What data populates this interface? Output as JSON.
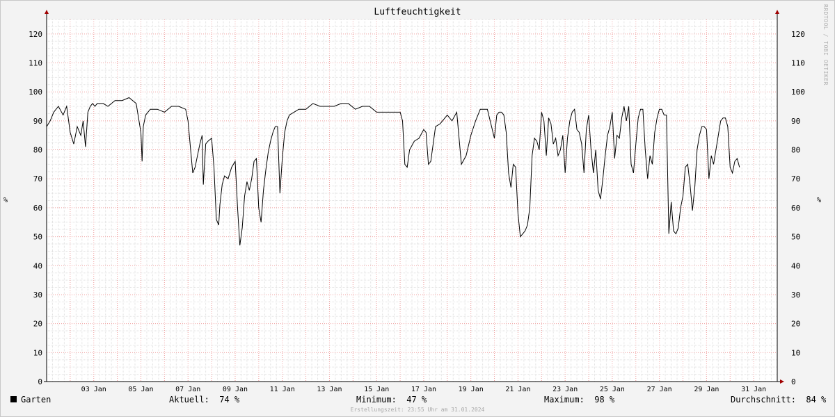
{
  "chart_data": {
    "type": "line",
    "title": "Luftfeuchtigkeit",
    "ylabel": "%",
    "ylim": [
      0,
      125
    ],
    "yticks": [
      0,
      10,
      20,
      30,
      40,
      50,
      60,
      70,
      80,
      90,
      100,
      110,
      120
    ],
    "xlim_days": [
      1.0,
      32.0
    ],
    "xtick_labels": [
      "03 Jan",
      "05 Jan",
      "07 Jan",
      "09 Jan",
      "11 Jan",
      "13 Jan",
      "15 Jan",
      "17 Jan",
      "19 Jan",
      "21 Jan",
      "23 Jan",
      "25 Jan",
      "27 Jan",
      "29 Jan",
      "31 Jan"
    ],
    "xtick_days": [
      3,
      5,
      7,
      9,
      11,
      13,
      15,
      17,
      19,
      21,
      23,
      25,
      27,
      29,
      31
    ],
    "grid": true,
    "series": [
      {
        "name": "Garten",
        "color": "#000000",
        "x_day": [
          1.0,
          1.15,
          1.3,
          1.5,
          1.7,
          1.85,
          2.0,
          2.15,
          2.3,
          2.45,
          2.55,
          2.65,
          2.75,
          2.85,
          2.95,
          3.05,
          3.15,
          3.25,
          3.4,
          3.6,
          3.9,
          4.2,
          4.5,
          4.8,
          5.0,
          5.05,
          5.1,
          5.2,
          5.4,
          5.7,
          6.0,
          6.3,
          6.6,
          6.9,
          7.0,
          7.1,
          7.2,
          7.3,
          7.5,
          7.6,
          7.65,
          7.75,
          7.85,
          8.0,
          8.1,
          8.2,
          8.3,
          8.35,
          8.45,
          8.55,
          8.7,
          8.85,
          9.0,
          9.1,
          9.2,
          9.3,
          9.4,
          9.5,
          9.6,
          9.7,
          9.8,
          9.9,
          10.0,
          10.1,
          10.2,
          10.3,
          10.4,
          10.5,
          10.6,
          10.7,
          10.8,
          10.9,
          11.0,
          11.1,
          11.2,
          11.3,
          11.5,
          11.7,
          12.0,
          12.3,
          12.6,
          12.9,
          13.2,
          13.5,
          13.8,
          14.1,
          14.4,
          14.7,
          15.0,
          15.2,
          15.4,
          15.7,
          16.0,
          16.1,
          16.2,
          16.3,
          16.4,
          16.6,
          16.8,
          17.0,
          17.1,
          17.2,
          17.3,
          17.5,
          17.7,
          18.0,
          18.2,
          18.4,
          18.6,
          18.8,
          19.0,
          19.2,
          19.4,
          19.7,
          20.0,
          20.1,
          20.2,
          20.3,
          20.4,
          20.5,
          20.6,
          20.7,
          20.8,
          20.9,
          21.0,
          21.1,
          21.2,
          21.3,
          21.4,
          21.5,
          21.6,
          21.7,
          21.8,
          21.9,
          22.0,
          22.1,
          22.2,
          22.3,
          22.4,
          22.5,
          22.6,
          22.7,
          22.8,
          22.9,
          23.0,
          23.1,
          23.2,
          23.3,
          23.4,
          23.5,
          23.6,
          23.7,
          23.8,
          23.9,
          24.0,
          24.1,
          24.2,
          24.3,
          24.4,
          24.5,
          24.6,
          24.7,
          24.8,
          24.9,
          25.0,
          25.1,
          25.2,
          25.3,
          25.4,
          25.5,
          25.6,
          25.7,
          25.8,
          25.9,
          26.0,
          26.1,
          26.2,
          26.3,
          26.4,
          26.5,
          26.6,
          26.7,
          26.8,
          26.9,
          27.0,
          27.1,
          27.2,
          27.3,
          27.4,
          27.5,
          27.6,
          27.7,
          27.8,
          27.9,
          28.0,
          28.1,
          28.2,
          28.3,
          28.4,
          28.5,
          28.6,
          28.7,
          28.8,
          28.9,
          29.0,
          29.1,
          29.2,
          29.3,
          29.4,
          29.5,
          29.6,
          29.7,
          29.8,
          29.9,
          30.0,
          30.1,
          30.2,
          30.3,
          30.4,
          30.5,
          30.6,
          30.7,
          30.8,
          30.9,
          31.0,
          31.1,
          31.2,
          31.3,
          31.4,
          31.5,
          31.6,
          31.7,
          31.8,
          31.9,
          32.0
        ],
        "values": [
          88,
          90,
          93,
          95,
          92,
          95,
          86,
          82,
          88,
          85,
          90,
          81,
          93,
          95,
          96,
          95,
          96,
          96,
          96,
          95,
          97,
          97,
          98,
          96,
          86,
          76,
          88,
          92,
          94,
          94,
          93,
          95,
          95,
          94,
          90,
          81,
          72,
          74,
          82,
          85,
          68,
          82,
          83,
          84,
          74,
          56,
          54,
          61,
          68,
          71,
          70,
          74,
          76,
          60,
          47,
          53,
          64,
          69,
          66,
          70,
          76,
          77,
          60,
          55,
          66,
          73,
          79,
          83,
          86,
          88,
          88,
          65,
          77,
          86,
          90,
          92,
          93,
          94,
          94,
          96,
          95,
          95,
          95,
          96,
          96,
          94,
          95,
          95,
          93,
          93,
          93,
          93,
          93,
          90,
          75,
          74,
          80,
          83,
          84,
          87,
          86,
          75,
          76,
          88,
          89,
          92,
          90,
          93,
          75,
          78,
          85,
          90,
          94,
          94,
          84,
          92,
          93,
          93,
          92,
          86,
          72,
          67,
          75,
          74,
          58,
          50,
          51,
          52,
          54,
          60,
          78,
          84,
          83,
          80,
          93,
          90,
          78,
          91,
          89,
          82,
          84,
          78,
          80,
          85,
          72,
          84,
          90,
          93,
          94,
          87,
          86,
          82,
          72,
          87,
          92,
          80,
          72,
          80,
          66,
          63,
          70,
          78,
          85,
          88,
          93,
          77,
          85,
          84,
          91,
          95,
          90,
          95,
          75,
          72,
          82,
          91,
          94,
          94,
          80,
          70,
          78,
          75,
          86,
          91,
          94,
          94,
          92,
          92,
          51,
          62,
          52,
          51,
          53,
          60,
          64,
          74,
          75,
          68,
          59,
          67,
          80,
          85,
          88,
          88,
          87,
          70,
          78,
          75,
          80,
          85,
          90,
          91,
          91,
          88,
          74,
          72,
          76,
          77,
          74
        ]
      }
    ]
  },
  "legend": {
    "series_name": "Garten",
    "aktuell_label": "Aktuell:",
    "aktuell_value": "74 %",
    "minimum_label": "Minimum:",
    "minimum_value": "47 %",
    "maximum_label": "Maximum:",
    "maximum_value": "98 %",
    "durchschnitt_label": "Durchschnitt:",
    "durchschnitt_value": "84 %"
  },
  "watermark": "RRDTOOL / TOBI OETIKER",
  "footer": "Erstellungszeit: 23:55 Uhr am 31.01.2024"
}
